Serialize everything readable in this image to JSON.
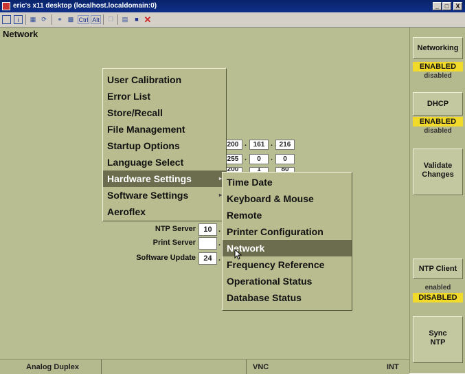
{
  "window": {
    "title": "eric's x11 desktop (localhost.localdomain:0)",
    "buttons": [
      "_",
      "□",
      "X"
    ]
  },
  "toolbar": {
    "items": [
      "doc-icon",
      "info-icon",
      "options-icon",
      "refresh-icon",
      "connect-icon",
      "keyboard-icon"
    ],
    "ctrl_label": "Ctrl",
    "alt_label": "Alt",
    "more_icons": [
      "copy-icon",
      "paste-icon",
      "save-icon",
      "disconnect-icon"
    ]
  },
  "page": {
    "title": "Network"
  },
  "fields": {
    "ip_rows": [
      [
        "200",
        "161",
        "216"
      ],
      [
        "255",
        "0",
        "0"
      ],
      [
        "200",
        "1",
        "80"
      ]
    ],
    "ntp_server": {
      "label": "NTP Server",
      "value": "10"
    },
    "print_server": {
      "label": "Print Server",
      "value": ""
    },
    "software_update": {
      "label": "Software Update",
      "value": "24"
    }
  },
  "main_menu": {
    "items": [
      "User Calibration",
      "Error List",
      "Store/Recall",
      "File Management",
      "Startup Options",
      "Language Select",
      "Hardware Settings",
      "Software Settings",
      "Aeroflex"
    ],
    "selected": "Hardware Settings"
  },
  "sub_menu": {
    "items": [
      "Time Date",
      "Keyboard & Mouse",
      "Remote",
      "Printer Configuration",
      "Network",
      "Frequency Reference",
      "Operational Status",
      "Database Status"
    ],
    "selected": "Network"
  },
  "sidebar": {
    "networking": {
      "label": "Networking",
      "on": "ENABLED",
      "off": "disabled"
    },
    "dhcp": {
      "label": "DHCP",
      "on": "ENABLED",
      "off": "disabled"
    },
    "validate": {
      "line1": "Validate",
      "line2": "Changes"
    },
    "ntp_client": {
      "label": "NTP Client",
      "off": "enabled",
      "on": "DISABLED"
    },
    "sync": {
      "line1": "Sync",
      "line2": "NTP"
    }
  },
  "status": {
    "mode": "Analog Duplex",
    "connection": "VNC",
    "ref": "INT"
  },
  "colors": {
    "background": "#b9be92",
    "highlight": "#f2da2a",
    "selected": "#6c6d4e",
    "titlebar": "#0a246a"
  }
}
